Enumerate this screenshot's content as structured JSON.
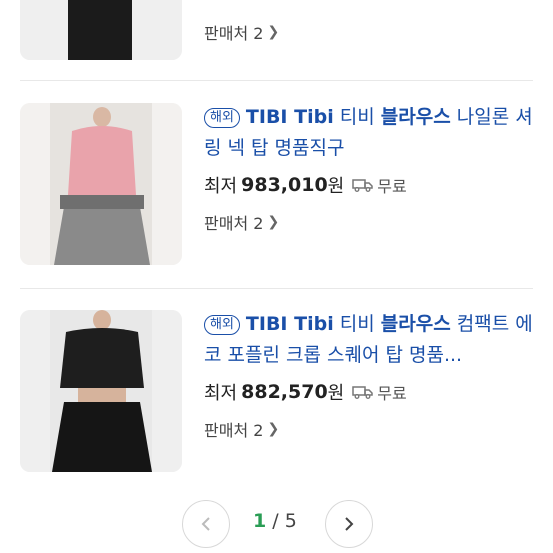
{
  "listing": {
    "top_item": {
      "sellers_label": "판매처 2"
    },
    "items": [
      {
        "badge": "해외",
        "brand": "TIBI Tibi",
        "title_plain_1": "티비",
        "keyword": "블라우스",
        "title_plain_2": "나일론 셔링 넥 탑 명품직구",
        "price_prefix": "최저",
        "price": "983,010",
        "currency": "원",
        "shipping": "무료",
        "sellers_label": "판매처 2",
        "image_colors": {
          "top": "#e9a3ab",
          "skirt": "#8a8a8a",
          "bg": "#f3f1ef"
        }
      },
      {
        "badge": "해외",
        "brand": "TIBI Tibi",
        "title_plain_1": "티비",
        "keyword": "블라우스",
        "title_plain_2": "컴팩트 에코 포플린 크롭 스퀘어 탑 명품...",
        "price_prefix": "최저",
        "price": "882,570",
        "currency": "원",
        "shipping": "무료",
        "sellers_label": "판매처 2",
        "image_colors": {
          "top": "#1e1e1e",
          "skirt": "#151515",
          "bg": "#efefef"
        }
      }
    ]
  },
  "pagination": {
    "current": "1",
    "separator": " / ",
    "total": "5"
  },
  "icons": {
    "truck": "truck-icon",
    "chevron_right": "chevron-right-icon",
    "prev": "chevron-left-icon",
    "next": "chevron-right-icon"
  },
  "colors": {
    "title": "#1a4fa8",
    "pager_current": "#2a9d55"
  }
}
